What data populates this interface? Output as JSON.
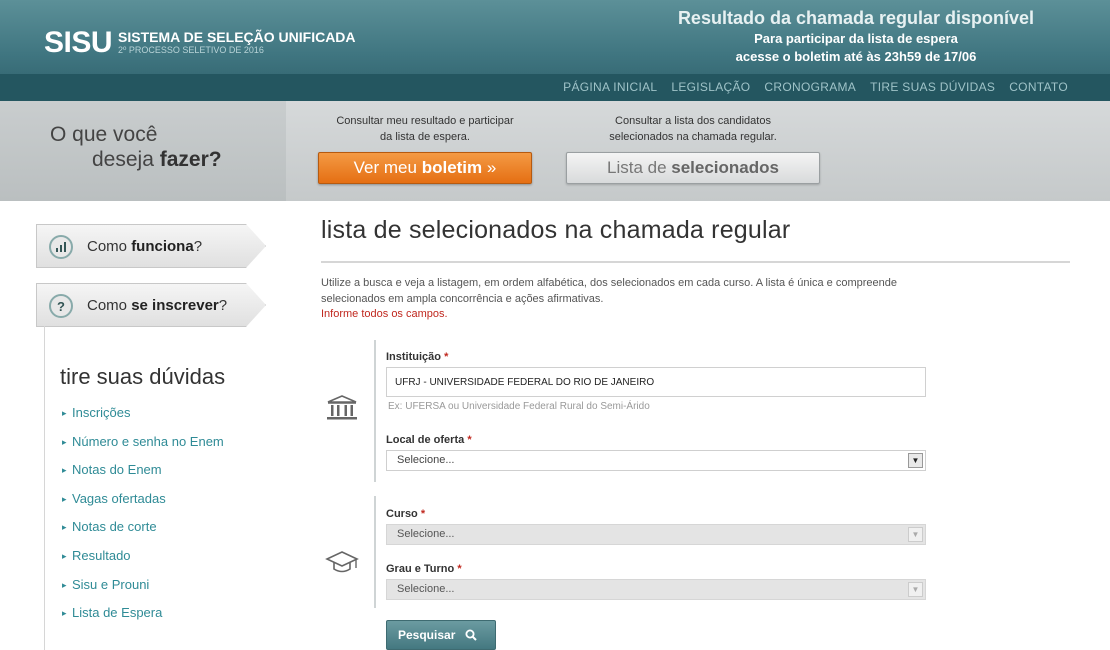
{
  "header": {
    "logo": "SISU",
    "logo_title": "SISTEMA DE SELEÇÃO UNIFICADA",
    "logo_subtitle": "2º PROCESSO SELETIVO DE 2016",
    "announcement_title": "Resultado da chamada regular disponível",
    "announcement_line1": "Para participar da lista de espera",
    "announcement_line2": "acesse o boletim até às 23h59 de 17/06",
    "nav": [
      "PÁGINA INICIAL",
      "LEGISLAÇÃO",
      "CRONOGRAMA",
      "TIRE SUAS DÚVIDAS",
      "CONTATO"
    ]
  },
  "band": {
    "question_line1": "O que você",
    "question_line2_prefix": "deseja ",
    "question_line2_bold": "fazer?",
    "action1_desc_line1": "Consultar meu resultado e participar",
    "action1_desc_line2": "da lista de espera.",
    "action1_button_prefix": "Ver meu ",
    "action1_button_bold": "boletim",
    "action1_button_suffix": " »",
    "action2_desc_line1": "Consultar a lista dos candidatos",
    "action2_desc_line2": "selecionados na chamada regular.",
    "action2_button_prefix": "Lista de ",
    "action2_button_bold": "selecionados"
  },
  "sidebar": {
    "tab1_prefix": "Como ",
    "tab1_bold": "funciona",
    "tab1_suffix": "?",
    "tab2_prefix": "Como ",
    "tab2_bold": "se inscrever",
    "tab2_suffix": "?",
    "faq_title": "tire suas dúvidas",
    "faq_items": [
      "Inscrições",
      "Número e senha no Enem",
      "Notas do Enem",
      "Vagas ofertadas",
      "Notas de corte",
      "Resultado",
      "Sisu e Prouni",
      "Lista de Espera"
    ]
  },
  "main": {
    "title": "lista de selecionados na chamada regular",
    "intro_line1": "Utilize a busca e veja a listagem, em ordem alfabética, dos selecionados em cada curso. A lista é única e compreende",
    "intro_line2": "selecionados em ampla concorrência e ações afirmativas.",
    "required_notice": "Informe todos os campos.",
    "institution_label": "Instituição",
    "institution_value": "UFRJ - UNIVERSIDADE FEDERAL DO RIO DE JANEIRO",
    "institution_hint": "Ex: UFERSA ou Universidade Federal Rural do Semi-Árido",
    "location_label": "Local de oferta",
    "location_value": "Selecione...",
    "course_label": "Curso",
    "course_value": "Selecione...",
    "degree_label": "Grau e Turno",
    "degree_value": "Selecione...",
    "required_mark": "*",
    "search_button": "Pesquisar"
  },
  "colors": {
    "header": "#3f7580",
    "accent_orange": "#e56f13",
    "link_teal": "#2f8b96",
    "required_red": "#c0281f"
  }
}
